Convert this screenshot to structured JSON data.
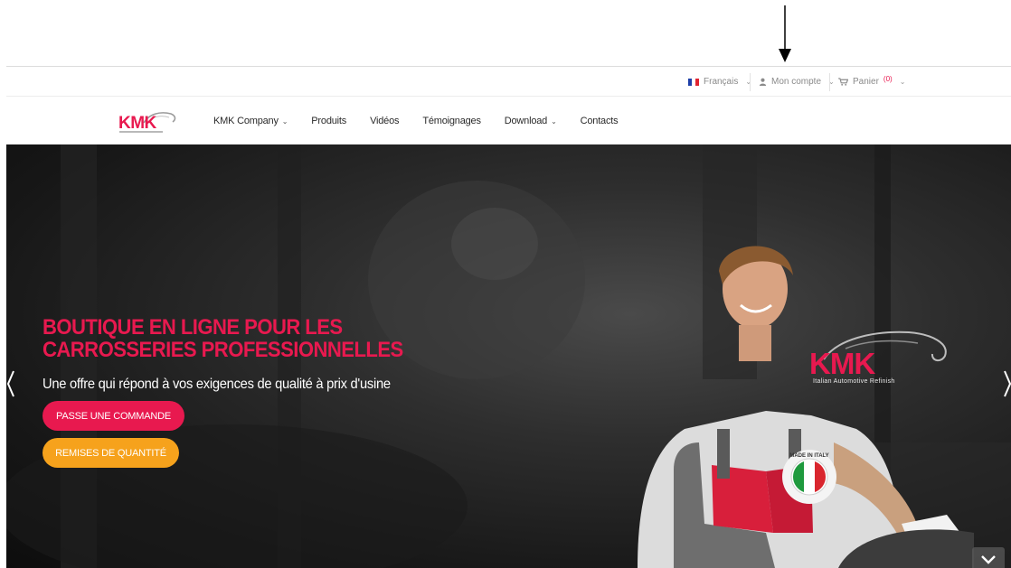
{
  "topbar": {
    "language": {
      "label": "Français",
      "flag_colors": [
        "#1e3fa8",
        "#ffffff",
        "#e02431"
      ]
    },
    "account": {
      "label": "Mon compte",
      "icon": "user-icon"
    },
    "cart": {
      "label": "Panier",
      "count": "(0)",
      "icon": "cart-icon"
    }
  },
  "nav": {
    "logo_text": "KMK",
    "items": [
      {
        "label": "KMK Company",
        "has_dropdown": true
      },
      {
        "label": "Produits",
        "has_dropdown": false
      },
      {
        "label": "Vidéos",
        "has_dropdown": false
      },
      {
        "label": "Témoignages",
        "has_dropdown": false
      },
      {
        "label": "Download",
        "has_dropdown": true
      },
      {
        "label": "Contacts",
        "has_dropdown": false
      }
    ]
  },
  "hero": {
    "title": "BOUTIQUE EN LIGNE POUR LES CARROSSERIES PROFESSIONNELLES",
    "subtitle": "Une offre qui répond à vos exigences de qualité à prix d'usine",
    "button_order": "PASSE UNE COMMANDE",
    "button_discount": "REMISES DE QUANTITÉ",
    "brand_logo": "KMK",
    "brand_tagline": "Italian Automotive Refinish",
    "badge_text": "MADE IN ITALY"
  },
  "colors": {
    "accent": "#e8194f",
    "secondary": "#f6a21c",
    "hero_text": "#ffffff",
    "nav_text": "#2a2a2a",
    "topbar_text": "#8a8a8a"
  }
}
